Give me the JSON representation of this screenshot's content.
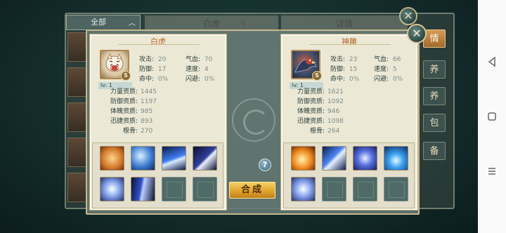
{
  "background": {
    "dropdown_label": "全部",
    "tab_center": "白虎",
    "tab_right": "详情",
    "side_menu": [
      "情",
      "养",
      "养",
      "包",
      "备"
    ]
  },
  "left_pet": {
    "name": "白虎",
    "level": "lv: 1",
    "grade_badge": "S",
    "stats": [
      {
        "label": "攻击:",
        "value": "20"
      },
      {
        "label": "气血:",
        "value": "70"
      },
      {
        "label": "防御:",
        "value": "17"
      },
      {
        "label": "速度:",
        "value": "4"
      },
      {
        "label": "命中:",
        "value": "0%"
      },
      {
        "label": "闪避:",
        "value": "0%"
      }
    ],
    "aptitudes": [
      {
        "label": "力量资质:",
        "value": "1445"
      },
      {
        "label": "防御资质:",
        "value": "1197"
      },
      {
        "label": "体魄资质:",
        "value": "985"
      },
      {
        "label": "迅捷资质:",
        "value": "893"
      },
      {
        "label": "根骨:",
        "value": "270"
      }
    ],
    "skills": [
      "tiger-claw-skill",
      "lightning-skill",
      "blade-wave-skill",
      "slash-skill",
      "orb-skill",
      "ice-spike-skill",
      "empty",
      "empty"
    ]
  },
  "right_pet": {
    "name": "神雕",
    "level": "lv: 1",
    "grade_badge": "S",
    "stats": [
      {
        "label": "攻击:",
        "value": "23"
      },
      {
        "label": "气血:",
        "value": "66"
      },
      {
        "label": "防御:",
        "value": "15"
      },
      {
        "label": "速度:",
        "value": "5"
      },
      {
        "label": "命中:",
        "value": "0%"
      },
      {
        "label": "闪避:",
        "value": "0%"
      }
    ],
    "aptitudes": [
      {
        "label": "力量资质:",
        "value": "1621"
      },
      {
        "label": "防御资质:",
        "value": "1092"
      },
      {
        "label": "体魄资质:",
        "value": "946"
      },
      {
        "label": "迅捷资质:",
        "value": "1098"
      },
      {
        "label": "根骨:",
        "value": "264"
      }
    ],
    "skills": [
      "fire-slash-skill",
      "ice-blade-skill",
      "shield-skill",
      "whirlwind-skill",
      "orb-skill",
      "empty",
      "empty",
      "empty"
    ]
  },
  "actions": {
    "compose_label": "合成",
    "help_label": "?",
    "close_label": "✕"
  },
  "colors": {
    "accent_title": "#b06a2a",
    "compose_button": "#e2a52c"
  }
}
